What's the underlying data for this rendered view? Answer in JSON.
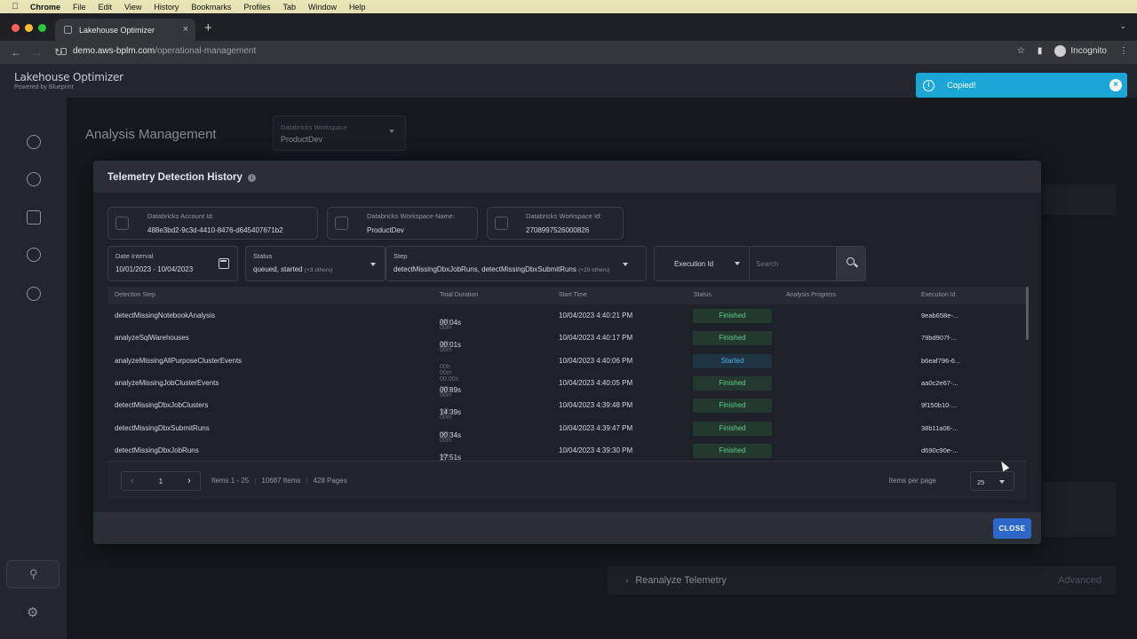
{
  "menubar": {
    "items": [
      "Chrome",
      "File",
      "Edit",
      "View",
      "History",
      "Bookmarks",
      "Profiles",
      "Tab",
      "Window",
      "Help"
    ]
  },
  "browser": {
    "tab_title": "Lakehouse Optimizer",
    "url_host": "demo.aws-bplm.com",
    "url_path": "/operational-management",
    "profile": "Incognito"
  },
  "app": {
    "logo": "Lakehouse Optimizer",
    "logo_sub": "Powered by Blueprint",
    "page_title": "Analysis Management",
    "workspace_label": "Databricks Workspace",
    "workspace_value": "ProductDev",
    "reanalyze_label": "Reanalyze Telemetry",
    "advanced_label": "Advanced"
  },
  "toast": {
    "message": "Copied!"
  },
  "modal": {
    "title": "Telemetry Detection History",
    "cards": [
      {
        "label": "Databricks Account Id:",
        "value": "488e3bd2-9c3d-4410-8476-d645407671b2"
      },
      {
        "label": "Databricks Workspace Name:",
        "value": "ProductDev"
      },
      {
        "label": "Databricks Workspace Id:",
        "value": "2708997526000826"
      }
    ],
    "filters": {
      "date_label": "Date Interval",
      "date_value": "10/01/2023 - 10/04/2023",
      "status_label": "Status",
      "status_value": "queued, started",
      "status_more": "(+3 others)",
      "step_label": "Step",
      "step_value": "detectMissingDbxJobRuns, detectMissingDbxSubmitRuns",
      "step_more": "(+29 others)",
      "exec_select": "Execution Id",
      "search_placeholder": "Search"
    },
    "columns": [
      "Detection Step",
      "Total Duration",
      "Start Time",
      "Status",
      "Analysis Progress",
      "Execution Id"
    ],
    "rows": [
      {
        "step": "detectMissingNotebookAnalysis",
        "dur_dim": "00h 00m",
        "dur": "00.04s",
        "start": "10/04/2023 4:40:21 PM",
        "status": "Finished",
        "exec": "9eab658e-..."
      },
      {
        "step": "analyzeSqlWarehouses",
        "dur_dim": "00h 00m",
        "dur": "00.01s",
        "start": "10/04/2023 4:40:17 PM",
        "status": "Finished",
        "exec": "79bd907f-..."
      },
      {
        "step": "analyzeMissingAllPurposeClusterEvents",
        "dur_dim": "00h 00m 00.00s",
        "dur": "",
        "start": "10/04/2023 4:40:06 PM",
        "status": "Started",
        "exec": "b6eaf796-6..."
      },
      {
        "step": "analyzeMissingJobClusterEvents",
        "dur_dim": "00h 00m",
        "dur": "00.89s",
        "start": "10/04/2023 4:40:05 PM",
        "status": "Finished",
        "exec": "aa0c2e67-..."
      },
      {
        "step": "detectMissingDbxJobClusters",
        "dur_dim": "00h 00m",
        "dur": "14.39s",
        "start": "10/04/2023 4:39:48 PM",
        "status": "Finished",
        "exec": "9f150b10-..."
      },
      {
        "step": "detectMissingDbxSubmitRuns",
        "dur_dim": "00h 00m",
        "dur": "00.34s",
        "start": "10/04/2023 4:39:47 PM",
        "status": "Finished",
        "exec": "38b11a06-..."
      },
      {
        "step": "detectMissingDbxJobRuns",
        "dur_dim": "00h 00m",
        "dur": "17.51s",
        "start": "10/04/2023 4:39:30 PM",
        "status": "Finished",
        "exec": "d690c90e-..."
      }
    ],
    "pager": {
      "page": "1",
      "items_range": "Items 1 - 25",
      "items_total": "10687 Items",
      "pages_total": "428 Pages",
      "ipp_label": "Items per page",
      "ipp_value": "25"
    },
    "close_label": "CLOSE"
  },
  "colors": {
    "finished": "#5fcf8f",
    "started": "#4db3e6",
    "toast": "#1aa7d8",
    "primary_button": "#2d68c8"
  }
}
